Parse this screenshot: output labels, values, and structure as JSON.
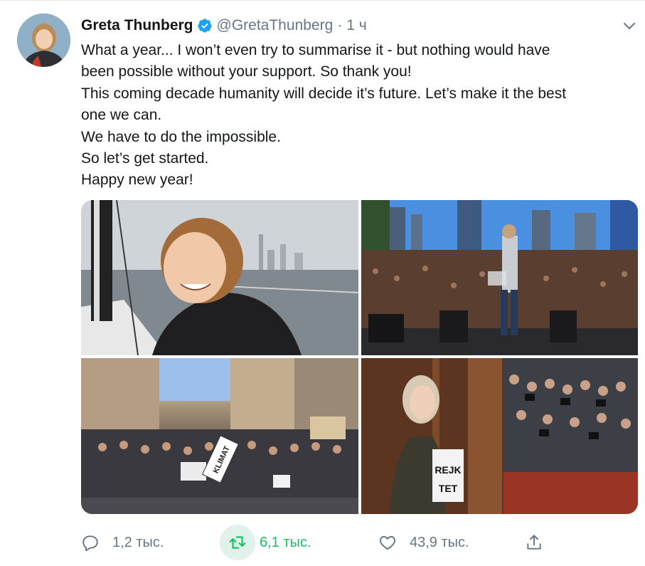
{
  "tweet": {
    "author_name": "Greta Thunberg",
    "author_handle": "@GretaThunberg",
    "separator": "·",
    "time": "1 ч",
    "lines": [
      "What a year... I won’t even try to summarise it - but nothing would have",
      "been possible without your support. So thank you!",
      "This coming decade humanity will decide it’s future. Let’s make it the best",
      "one we can.",
      "We have to do the impossible.",
      "So let’s get started.",
      "Happy new year!"
    ],
    "photo_signs": {
      "sign1": "KLIMAT",
      "sign2": "REJK\nTET"
    }
  },
  "actions": {
    "reply_count": "1,2 тыс.",
    "retweet_count": "6,1 тыс.",
    "like_count": "43,9 тыс."
  },
  "icons": {
    "verified": "verified-badge-icon",
    "caret": "chevron-down-icon",
    "reply": "reply-icon",
    "retweet": "retweet-icon",
    "like": "heart-icon",
    "share": "share-icon"
  },
  "colors": {
    "verified_blue": "#1da1f2",
    "retweet_green": "#17bf63",
    "secondary_text": "#657786"
  }
}
